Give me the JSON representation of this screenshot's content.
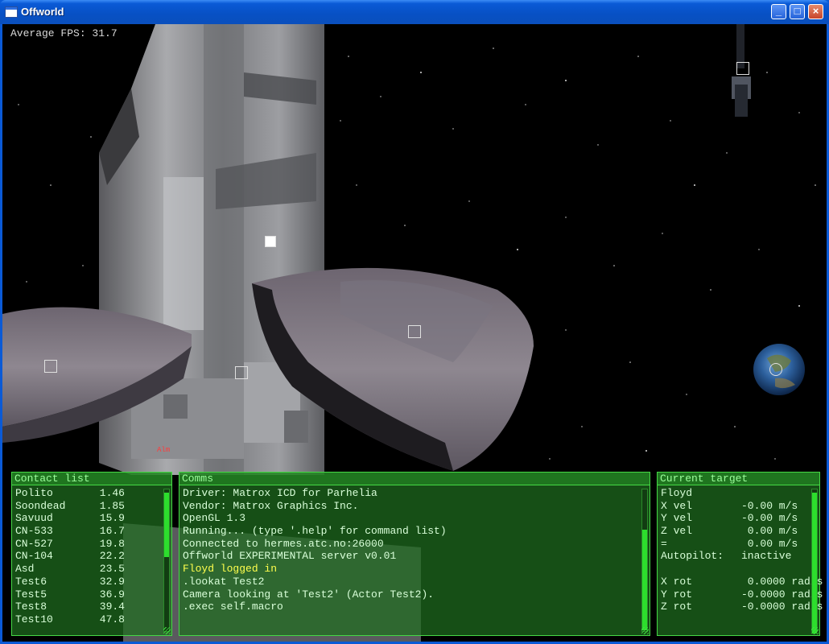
{
  "window": {
    "title": "Offworld"
  },
  "hud": {
    "fps_text": "Average FPS: 31.7",
    "target_tag": "Alm"
  },
  "contacts": {
    "title": "Contact list",
    "items": [
      {
        "name": "Polito",
        "dist": "1.46"
      },
      {
        "name": "Soondead",
        "dist": "1.85"
      },
      {
        "name": "Savuud",
        "dist": "15.9"
      },
      {
        "name": "CN-533",
        "dist": "16.7"
      },
      {
        "name": "CN-527",
        "dist": "19.8"
      },
      {
        "name": "CN-104",
        "dist": "22.2"
      },
      {
        "name": "Asd",
        "dist": "23.5"
      },
      {
        "name": "Test6",
        "dist": "32.9"
      },
      {
        "name": "Test5",
        "dist": "36.9"
      },
      {
        "name": "Test8",
        "dist": "39.4"
      },
      {
        "name": "Test10",
        "dist": "47.8"
      }
    ]
  },
  "comms": {
    "title": "Comms",
    "lines": [
      {
        "text": "Driver: Matrox ICD for Parhelia",
        "hl": false
      },
      {
        "text": "Vendor: Matrox Graphics Inc.",
        "hl": false
      },
      {
        "text": "OpenGL 1.3",
        "hl": false
      },
      {
        "text": "Running... (type '.help' for command list)",
        "hl": false
      },
      {
        "text": "Connected to hermes.atc.no:26000",
        "hl": false
      },
      {
        "text": "Offworld EXPERIMENTAL server v0.01",
        "hl": false
      },
      {
        "text": "Floyd logged in",
        "hl": true
      },
      {
        "text": ".lookat Test2",
        "hl": false
      },
      {
        "text": "Camera looking at 'Test2' (Actor Test2).",
        "hl": false
      },
      {
        "text": ".exec self.macro",
        "hl": false
      }
    ]
  },
  "target": {
    "title": "Current target",
    "name": "Floyd",
    "rows": [
      {
        "label": "X vel",
        "value": "-0.00 m/s"
      },
      {
        "label": "Y vel",
        "value": "-0.00 m/s"
      },
      {
        "label": "Z vel",
        "value": " 0.00 m/s"
      },
      {
        "label": "=",
        "value": " 0.00 m/s"
      },
      {
        "label": "Autopilot:",
        "value": "inactive"
      },
      {
        "label": "",
        "value": ""
      },
      {
        "label": "X rot",
        "value": " 0.0000 rad/s"
      },
      {
        "label": "Y rot",
        "value": "-0.0000 rad/s"
      },
      {
        "label": "Z rot",
        "value": "-0.0000 rad/s"
      }
    ]
  }
}
